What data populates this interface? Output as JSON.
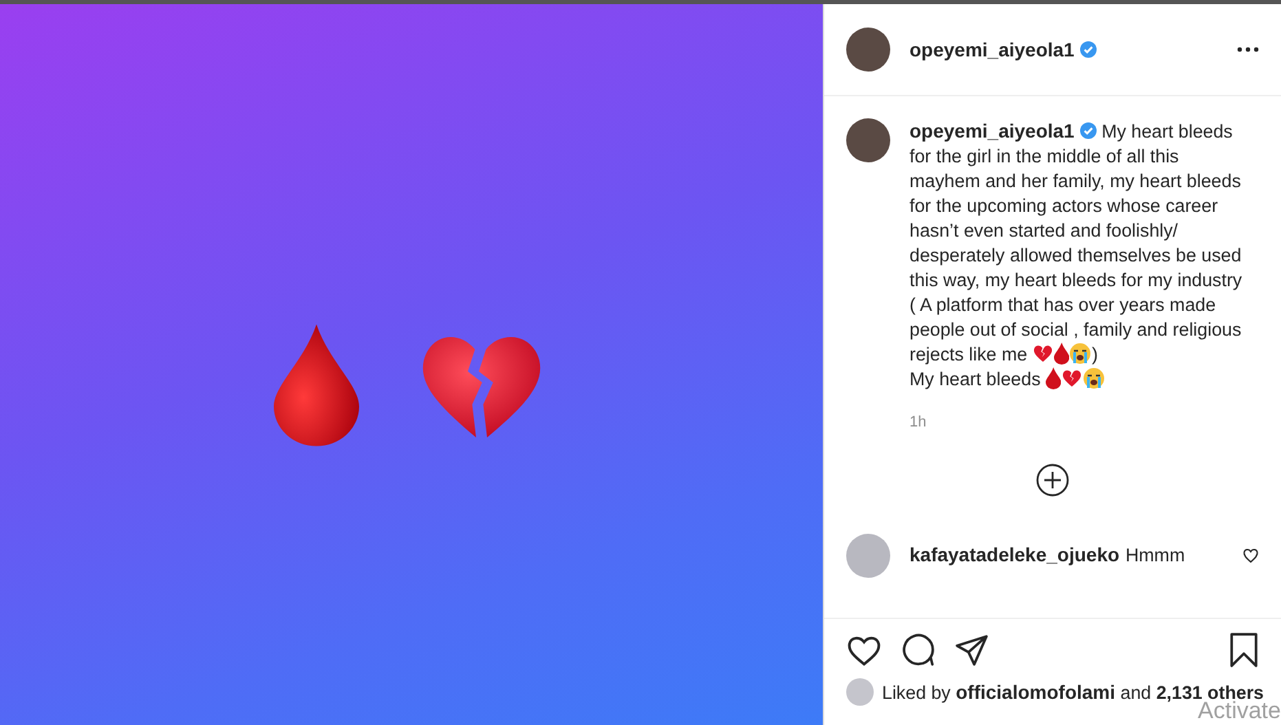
{
  "post_header": {
    "username": "opeyemi_aiyeola1",
    "verified": true
  },
  "caption": {
    "username": "opeyemi_aiyeola1",
    "verified": true,
    "parts": [
      {
        "kind": "text",
        "text": "My heart bleeds for the girl in the middle of all this mayhem and her family, my heart bleeds for the upcoming actors whose career hasn’t even started and foolishly/ desperately allowed themselves be used this way, my heart bleeds for my industry ( A platform that has over years made people out of social , family and religious rejects like me "
      },
      {
        "kind": "heart"
      },
      {
        "kind": "drop"
      },
      {
        "kind": "crying"
      },
      {
        "kind": "text",
        "text": ")"
      },
      {
        "kind": "break"
      },
      {
        "kind": "text",
        "text": "My heart bleeds "
      },
      {
        "kind": "drop"
      },
      {
        "kind": "heart"
      },
      {
        "kind": "crying"
      }
    ],
    "time": "1h"
  },
  "comments": [
    {
      "username": "kafayatadeleke_ojueko",
      "text": "Hmmm",
      "liked": false
    }
  ],
  "likes": {
    "prefix": "Liked by",
    "user": "officialomofolami",
    "middle": "and",
    "count": "2,131 others"
  },
  "overlay": {
    "text": "Activate"
  }
}
